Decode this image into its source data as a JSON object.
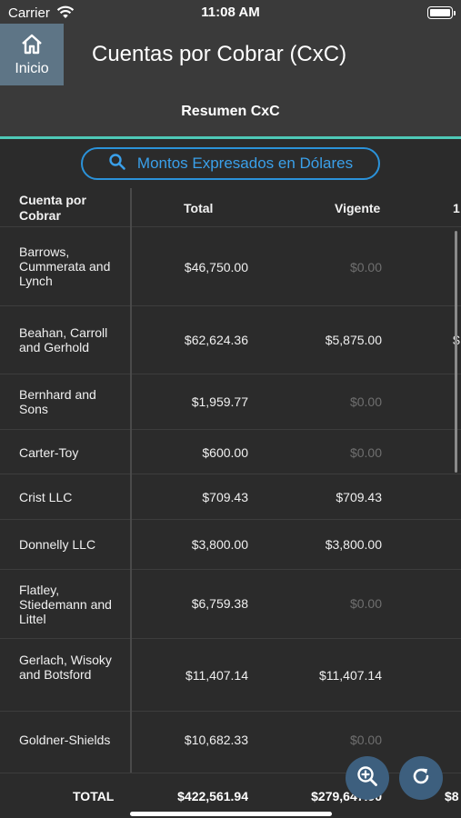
{
  "status_bar": {
    "carrier": "Carrier",
    "time": "11:08 AM"
  },
  "header": {
    "home_label": "Inicio",
    "title": "Cuentas por Cobrar (CxC)",
    "subtitle": "Resumen CxC"
  },
  "currency_pill": {
    "label": "Montos Expresados en Dólares",
    "icon": "search-icon"
  },
  "table": {
    "columns": [
      "Cuenta por Cobrar",
      "Total",
      "Vigente",
      "1"
    ],
    "rows": [
      {
        "name": "Barrows, Cummerata and Lynch",
        "total": "$46,750.00",
        "vigente": "$0.00",
        "extra": ""
      },
      {
        "name": "Beahan, Carroll and Gerhold",
        "total": "$62,624.36",
        "vigente": "$5,875.00",
        "extra": "$"
      },
      {
        "name": "Bernhard and Sons",
        "total": "$1,959.77",
        "vigente": "$0.00",
        "extra": ""
      },
      {
        "name": "Carter-Toy",
        "total": "$600.00",
        "vigente": "$0.00",
        "extra": ""
      },
      {
        "name": "Crist LLC",
        "total": "$709.43",
        "vigente": "$709.43",
        "extra": ""
      },
      {
        "name": "Donnelly LLC",
        "total": "$3,800.00",
        "vigente": "$3,800.00",
        "extra": ""
      },
      {
        "name": "Flatley, Stiedemann and Littel",
        "total": "$6,759.38",
        "vigente": "$0.00",
        "extra": ""
      },
      {
        "name": "Gerlach, Wisoky and Botsford",
        "total": "$11,407.14",
        "vigente": "$11,407.14",
        "extra": ""
      },
      {
        "name": "Goldner-Shields",
        "total": "$10,682.33",
        "vigente": "$0.00",
        "extra": ""
      }
    ],
    "totals": {
      "label": "TOTAL",
      "total": "$422,561.94",
      "vigente": "$279,647.90",
      "extra": "$8"
    }
  },
  "actions": {
    "zoom_icon": "zoom-in-icon",
    "refresh_icon": "refresh-icon"
  },
  "colors": {
    "accent": "#4ec9b7",
    "link": "#2b92d9",
    "home_bg": "#5e7586",
    "fab_bg": "#3d5f7e",
    "zero_text": "#6f6f6f"
  }
}
